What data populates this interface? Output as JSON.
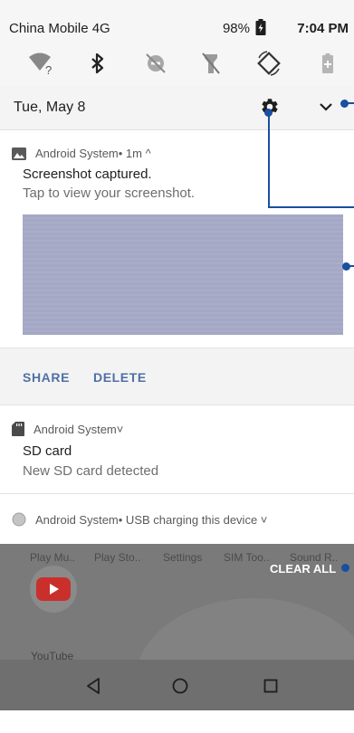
{
  "status_bar": {
    "carrier": "China Mobile 4G",
    "battery_percent": "98%",
    "time": "7:04 PM"
  },
  "quick_settings": [
    {
      "icon": "wifi-off-icon"
    },
    {
      "icon": "bluetooth-icon"
    },
    {
      "icon": "do-not-disturb-icon"
    },
    {
      "icon": "flashlight-off-icon"
    },
    {
      "icon": "auto-rotate-icon"
    },
    {
      "icon": "battery-saver-icon"
    }
  ],
  "header": {
    "date": "Tue, May 8"
  },
  "notifications": [
    {
      "app": "Android System",
      "meta": " • 1m ^",
      "title": "Screenshot captured.",
      "text": "Tap to view your screenshot.",
      "actions": [
        "SHARE",
        "DELETE"
      ]
    },
    {
      "app": "Android System",
      "meta": " ˅",
      "title": "SD card",
      "text": "New SD card detected"
    },
    {
      "app": "Android System",
      "meta": " • USB charging this device ˅"
    }
  ],
  "recents": {
    "apps": [
      "Play Mu..",
      "Play Sto..",
      "Settings",
      "SIM Too..",
      "Sound R.."
    ],
    "clear_all": "CLEAR ALL",
    "card_label": "YouTube"
  },
  "colors": {
    "accent": "#4f70a6",
    "callout": "#1a4fa0",
    "youtube_red": "#c9302c"
  }
}
